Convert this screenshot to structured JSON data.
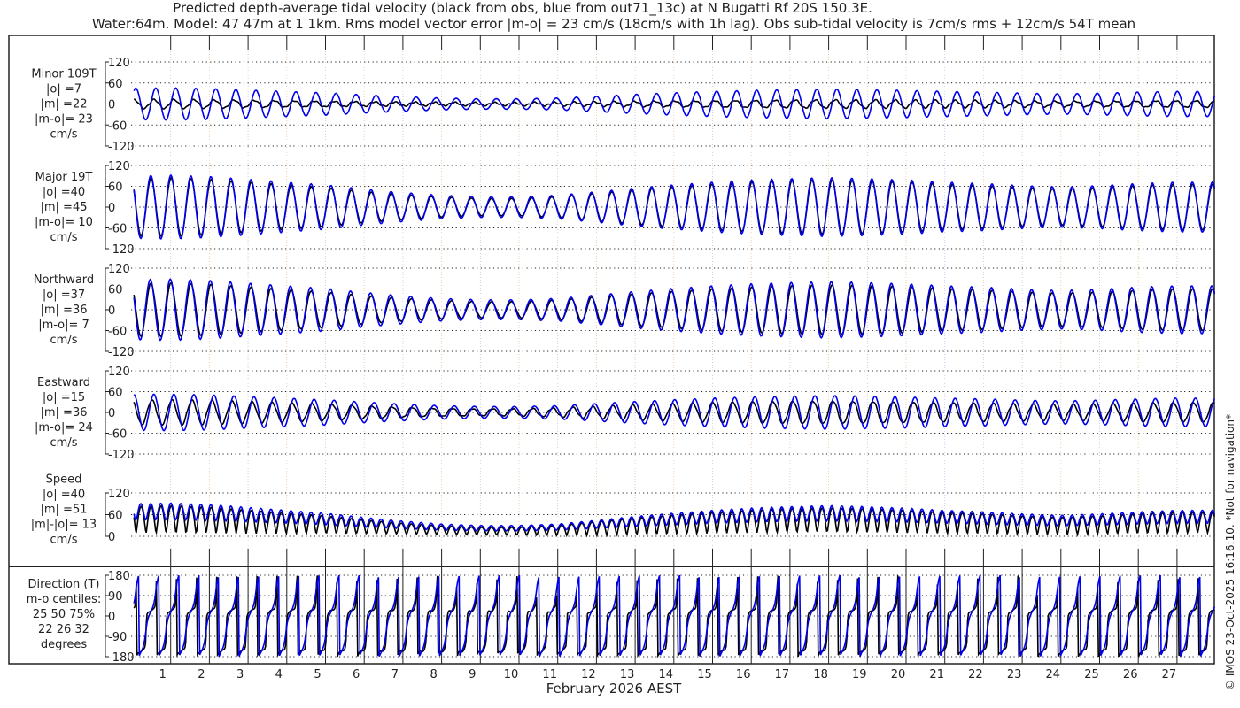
{
  "chart_data": {
    "type": "line",
    "title": "Predicted depth-average tidal velocity (black from obs, blue from out71_13c) at N Bugatti Rf 20S 150.3E.",
    "subtitle": "Water:64m. Model: 47 47m at 1 1km. Rms model vector error |m-o| = 23 cm/s (18cm/s with 1h lag). Obs sub-tidal velocity is 7cm/s rms + 12cm/s 54T mean",
    "xlabel": "February 2026 AEST",
    "x_ticks": [
      "1",
      "2",
      "3",
      "4",
      "5",
      "6",
      "7",
      "8",
      "9",
      "10",
      "11",
      "12",
      "13",
      "14",
      "15",
      "16",
      "17",
      "18",
      "19",
      "20",
      "21",
      "22",
      "23",
      "24",
      "25",
      "26",
      "27"
    ],
    "xlim_days": [
      0,
      28
    ],
    "tidal_period_hours": 12.42,
    "series_legend": {
      "obs": "black",
      "model": "blue"
    },
    "colors": {
      "obs": "#000000",
      "model": "#0000ee",
      "grid": "#000000"
    },
    "major_axis_deg": 19,
    "daily_major_amplitude_model": [
      90,
      92,
      88,
      80,
      72,
      64,
      52,
      42,
      34,
      30,
      30,
      34,
      44,
      55,
      64,
      72,
      78,
      82,
      85,
      82,
      78,
      72,
      68,
      62,
      58,
      62,
      68,
      72,
      72
    ],
    "daily_major_amplitude_obs": [
      82,
      84,
      80,
      72,
      64,
      56,
      45,
      36,
      29,
      25,
      25,
      30,
      40,
      50,
      58,
      66,
      72,
      76,
      78,
      76,
      72,
      66,
      62,
      56,
      52,
      56,
      62,
      66,
      66
    ],
    "panels": [
      {
        "id": "minor",
        "lines": [
          "Minor 109T",
          "|o| =7",
          "|m| =22",
          "|m-o|= 23",
          "cm/s"
        ],
        "yticks": [
          "120",
          "60",
          "0",
          "-60",
          "-120"
        ],
        "ylim": [
          -120,
          120
        ]
      },
      {
        "id": "major",
        "lines": [
          "Major 19T",
          "|o| =40",
          "|m| =45",
          "|m-o|= 10",
          "cm/s"
        ],
        "yticks": [
          "120",
          "60",
          "0",
          "-60",
          "-120"
        ],
        "ylim": [
          -120,
          120
        ]
      },
      {
        "id": "north",
        "lines": [
          "Northward",
          "|o| =37",
          "|m| =36",
          "|m-o|= 7",
          "cm/s"
        ],
        "yticks": [
          "120",
          "60",
          "0",
          "-60",
          "-120"
        ],
        "ylim": [
          -120,
          120
        ]
      },
      {
        "id": "east",
        "lines": [
          "Eastward",
          "|o| =15",
          "|m| =36",
          "|m-o|= 24",
          "cm/s"
        ],
        "yticks": [
          "120",
          "60",
          "0",
          "-60",
          "-120"
        ],
        "ylim": [
          -120,
          120
        ]
      },
      {
        "id": "speed",
        "lines": [
          "Speed",
          "|o| =40",
          "|m| =51",
          "|m|-|o|= 13",
          "cm/s"
        ],
        "yticks": [
          "120",
          "60",
          "0"
        ],
        "ylim": [
          0,
          120
        ]
      },
      {
        "id": "dir",
        "lines": [
          "Direction (T)",
          "m-o centiles:",
          "25  50  75%",
          "22  26  32",
          "degrees"
        ],
        "yticks": [
          "180",
          "90",
          "0",
          "-90",
          "-180"
        ],
        "ylim": [
          -180,
          180
        ]
      }
    ]
  },
  "copyright": "© IMOS 23-Oct-2025 16:16:10. *Not for navigation*"
}
